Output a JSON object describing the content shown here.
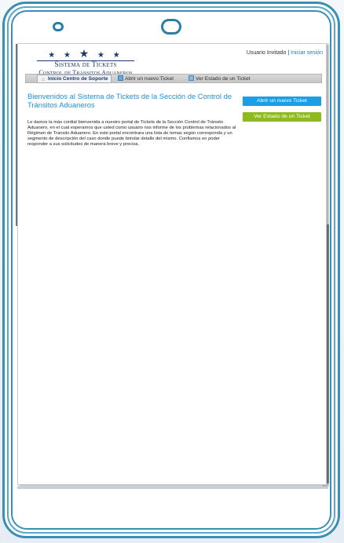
{
  "header": {
    "logo": {
      "line1": "Sistema de Tickets",
      "line2": "Control de Tránsitos Aduaneros"
    },
    "user_status": "Usuario Invitado",
    "separator": "|",
    "login_link": "Iniciar sesión"
  },
  "nav": {
    "items": [
      {
        "label": "Inicio Centro de Soporte",
        "icon": "home-icon",
        "active": true
      },
      {
        "label": "Abrir un nuevo Ticket",
        "icon": "new-ticket-icon",
        "active": false
      },
      {
        "label": "Ver Estado de un Ticket",
        "icon": "ticket-status-icon",
        "active": false
      }
    ]
  },
  "main": {
    "title": "Bienvenidos al Sistema de Tickets de la Sección de Control de Tránsitos Aduaneros",
    "body": "Le damos la más cordial bienvenida a nuestro portal de Tickets de la Sección Control de Tránsito Aduanero, en el cual esperamos que usted como usuario nos informe de los problemas relacionados al Régimen de Transito Aduanero. En este portal encontrara una lista de temas según corresponda y un segmento de descripción del caso donde puede brindar detalle del mismo. Confiamos en poder responder a sus solicitudes de manera breve y precisa."
  },
  "sidebar": {
    "open_ticket_button": "Abrir un nuevo Ticket",
    "check_status_button": "Ver Estado de un Ticket"
  },
  "colors": {
    "frame": "#3c8fb4",
    "title": "#1f8fe0",
    "open_button": "#1a9ee8",
    "status_button": "#8dbb1c",
    "logo_text": "#1f3a6e"
  }
}
